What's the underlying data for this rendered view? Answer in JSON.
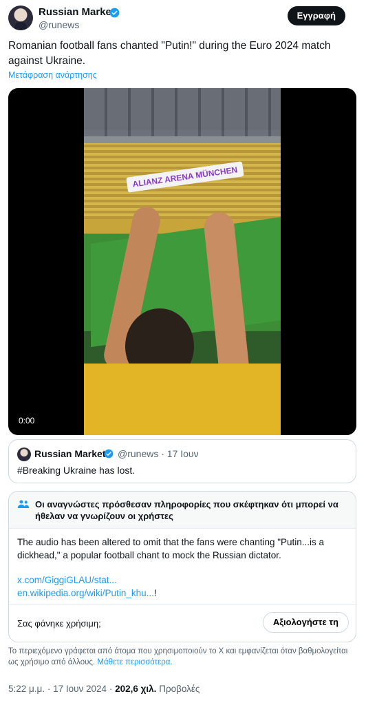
{
  "author": {
    "name": "Russian Market",
    "handle": "@runews"
  },
  "header": {
    "follow_label": "Εγγραφή"
  },
  "tweet": {
    "text": "Romanian football fans chanted \"Putin!\" during the Euro 2024 match against Ukraine.",
    "translate_label": "Μετάφραση ανάρτησης"
  },
  "media": {
    "video_time": "0:00",
    "location_sticker": "ALIANZ ARENA MÜNCHEN"
  },
  "quote": {
    "name": "Russian Market",
    "handle": "@runews",
    "separator": "·",
    "date": "17 Ιουν",
    "text": "#Breaking Ukraine has lost."
  },
  "note": {
    "title": "Οι αναγνώστες πρόσθεσαν πληροφορίες που σκέφτηκαν ότι μπορεί να ήθελαν να γνωρίζουν οι χρήστες",
    "body": "The audio has been altered to omit that the fans were chanting \"Putin...is a dickhead,\" a popular football chant to mock the Russian dictator.",
    "link1": "x.com/GiggiGLAU/stat...",
    "link2": "en.wikipedia.org/wiki/Putin_khu...",
    "link2_suffix": "!",
    "helpful_question": "Σας φάνηκε χρήσιμη;",
    "rate_label": "Αξιολογήστε τη"
  },
  "disclaimer": {
    "text": "Το περιεχόμενο γράφεται από άτομα που χρησιμοποιούν το X και εμφανίζεται όταν βαθμολογείται ως χρήσιμο από άλλους.",
    "learn_more": "Μάθετε περισσότερα",
    "period": "."
  },
  "meta": {
    "time": "5:22 μ.μ.",
    "dot": "·",
    "date": "17 Ιουν 2024",
    "dot2": "·",
    "views": "202,6 χιλ.",
    "views_label": "Προβολές"
  },
  "colors": {
    "accent": "#1d9bf0",
    "text": "#0f1419",
    "muted": "#536471",
    "border": "#cfd9de"
  },
  "icons": {
    "verified": "verified-badge-icon",
    "people": "people-icon"
  }
}
